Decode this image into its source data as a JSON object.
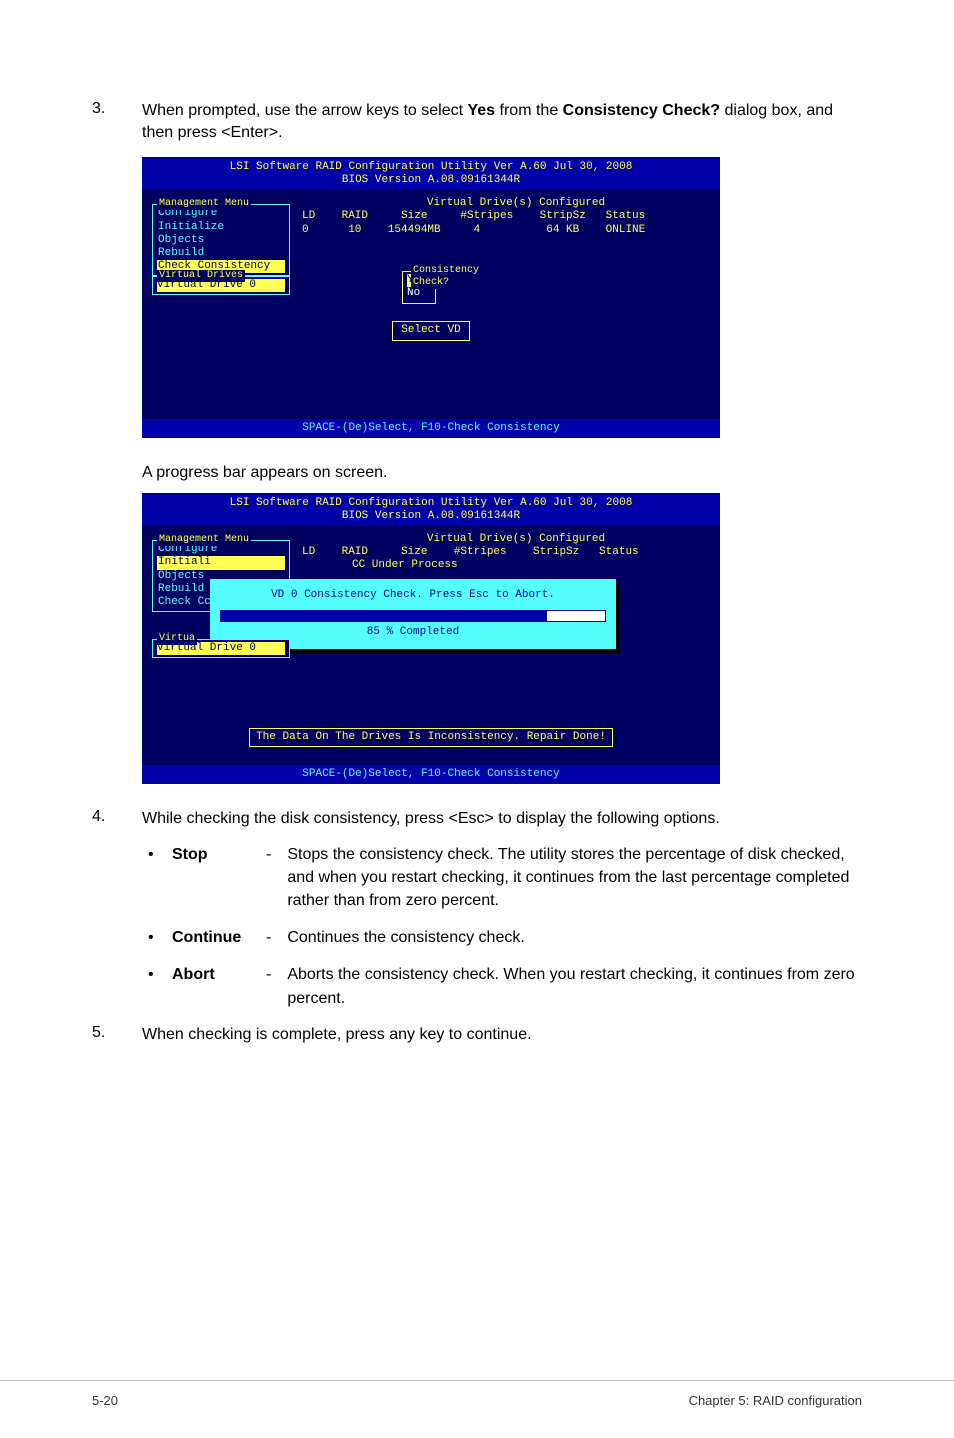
{
  "step3": {
    "num": "3.",
    "line1_pre": "When prompted, use the arrow keys to select ",
    "line1_b1": "Yes",
    "line1_mid": " from the ",
    "line1_b2": "Consistency Check?",
    "line1_post": " dialog box, and then press <Enter>."
  },
  "ss": {
    "title1": "LSI Software RAID Configuration Utility Ver A.60 Jul 30, 2008",
    "title2": "BIOS Version   A.08.09161344R",
    "vd_configured": "Virtual Drive(s) Configured",
    "mgmt_title": "Management Menu",
    "mgmt_items": [
      "Configure",
      "Initialize",
      "Objects",
      "Rebuild",
      "Check Consistency"
    ],
    "chart_data": {
      "type": "table",
      "columns": [
        "LD",
        "RAID",
        "Size",
        "#Stripes",
        "StripSz",
        "Status"
      ],
      "rows": [
        [
          "0",
          "10",
          "154494MB",
          "4",
          "64 KB",
          "ONLINE"
        ]
      ]
    },
    "cc_title": "Consistency Check?",
    "cc_opts": [
      "Yes",
      "No"
    ],
    "vd_title": "Virtual Drives",
    "vd_item": "Virtual Drive 0",
    "select_vd": "Select VD",
    "footer": "SPACE-(De)Select,   F10-Check Consistency"
  },
  "progress_caption": "A progress bar appears on screen.",
  "ss2": {
    "mgmt_items": [
      "Configure",
      "Initiali",
      "Objects",
      "Rebuild",
      "Check Cc"
    ],
    "col_header": "LD    RAID     Size    #Stripes    StripSz   Status",
    "under_process": "CC Under Process",
    "progress_msg": "VD 0 Consistency Check. Press Esc to Abort.",
    "progress_pct": "85 % Completed",
    "vd_title": "Virtua",
    "vd_item": "Virtual Drive 0",
    "repair": "The Data On The Drives Is Inconsistency. Repair Done!"
  },
  "step4": {
    "num": "4.",
    "text": "While checking the disk consistency, press <Esc> to display the following options.",
    "opts": [
      {
        "name": "Stop",
        "dash": "-",
        "desc": "Stops the consistency check. The utility stores the percentage of disk checked, and when you restart checking, it continues from the last percentage completed rather than from zero percent."
      },
      {
        "name": "Continue",
        "dash": "-",
        "desc": "Continues the consistency check."
      },
      {
        "name": "Abort",
        "dash": "-",
        "desc": "Aborts the consistency check. When you restart checking, it continues from zero percent."
      }
    ]
  },
  "step5": {
    "num": "5.",
    "text": "When checking is complete, press any key to continue."
  },
  "footer": {
    "page": "5-20",
    "chapter": "Chapter 5: RAID configuration"
  }
}
